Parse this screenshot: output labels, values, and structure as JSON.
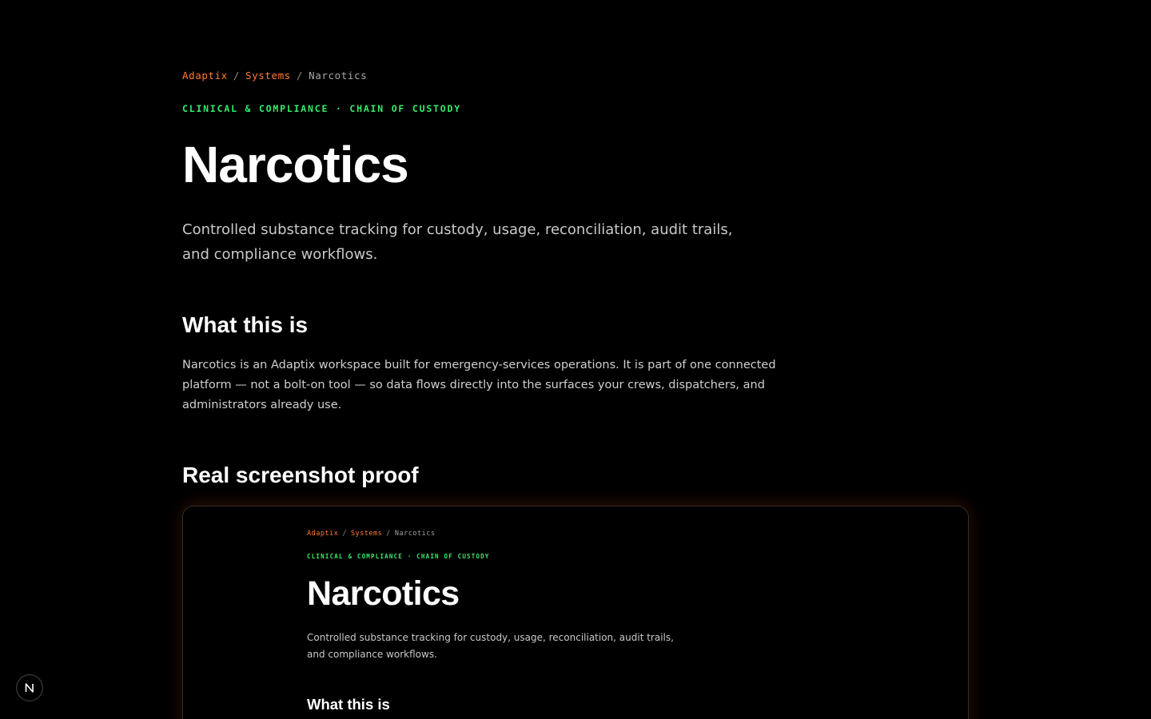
{
  "breadcrumb": {
    "items": [
      "Adaptix",
      "Systems",
      "Narcotics"
    ],
    "separator": "/"
  },
  "kicker": "CLINICAL & COMPLIANCE · CHAIN OF CUSTODY",
  "title": "Narcotics",
  "lede": "Controlled substance tracking for custody, usage, reconciliation, audit trails, and compliance workflows.",
  "what_section": {
    "heading": "What this is",
    "body": "Narcotics is an Adaptix workspace built for emergency-services operations. It is part of one connected platform — not a bolt-on tool — so data flows directly into the surfaces your crews, dispatchers, and administrators already use."
  },
  "proof_section": {
    "heading": "Real screenshot proof",
    "screenshot": {
      "breadcrumb": [
        "Adaptix",
        "Systems",
        "Narcotics"
      ],
      "kicker": "CLINICAL & COMPLIANCE · CHAIN OF CUSTODY",
      "title": "Narcotics",
      "lede": "Controlled substance tracking for custody, usage, reconciliation, audit trails, and compliance workflows.",
      "heading": "What this is"
    }
  },
  "dev_badge": {
    "icon": "n-logo-icon",
    "letter": "N"
  },
  "colors": {
    "background": "#000000",
    "breadcrumb_link": "#ff7a2f",
    "kicker": "#35ec6a",
    "text_primary": "#ffffff",
    "text_secondary": "#c9c9c9"
  }
}
